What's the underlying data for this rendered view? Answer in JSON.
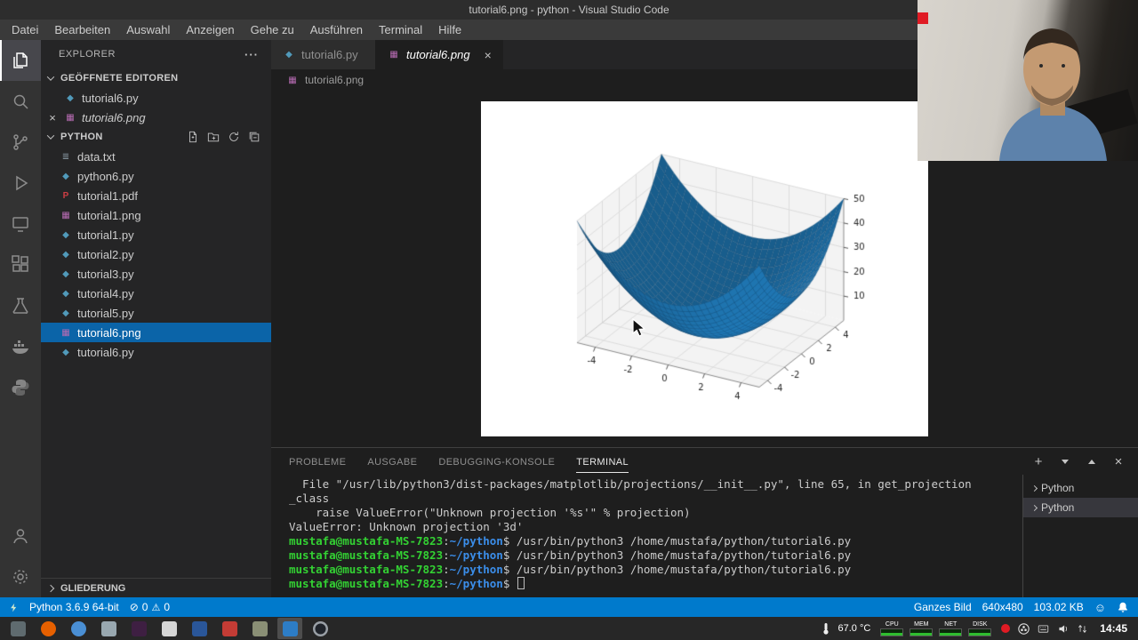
{
  "window": {
    "title": "tutorial6.png - python - Visual Studio Code"
  },
  "menu": {
    "items": [
      "Datei",
      "Bearbeiten",
      "Auswahl",
      "Anzeigen",
      "Gehe zu",
      "Ausführen",
      "Terminal",
      "Hilfe"
    ]
  },
  "activity_bar": {
    "top": [
      {
        "icon": "explorer",
        "active": true
      },
      {
        "icon": "search"
      },
      {
        "icon": "source-control"
      },
      {
        "icon": "run-debug"
      },
      {
        "icon": "remote-explorer"
      },
      {
        "icon": "extensions"
      },
      {
        "icon": "test-explorer"
      },
      {
        "icon": "docker"
      },
      {
        "icon": "python-env"
      }
    ],
    "bottom": [
      {
        "icon": "account"
      },
      {
        "icon": "settings"
      }
    ]
  },
  "sidebar": {
    "title": "EXPLORER",
    "open_editors_label": "GEÖFFNETE EDITOREN",
    "open_editors": [
      {
        "name": "tutorial6.py",
        "type": "py"
      },
      {
        "name": "tutorial6.png",
        "type": "img",
        "italic": true,
        "close": true
      }
    ],
    "folder_label": "PYTHON",
    "files": [
      {
        "name": "data.txt",
        "type": "txt"
      },
      {
        "name": "python6.py",
        "type": "py"
      },
      {
        "name": "tutorial1.pdf",
        "type": "pdf"
      },
      {
        "name": "tutorial1.png",
        "type": "img"
      },
      {
        "name": "tutorial1.py",
        "type": "py"
      },
      {
        "name": "tutorial2.py",
        "type": "py"
      },
      {
        "name": "tutorial3.py",
        "type": "py"
      },
      {
        "name": "tutorial4.py",
        "type": "py"
      },
      {
        "name": "tutorial5.py",
        "type": "py"
      },
      {
        "name": "tutorial6.png",
        "type": "img",
        "selected": true
      },
      {
        "name": "tutorial6.py",
        "type": "py"
      }
    ],
    "outline_label": "GLIEDERUNG"
  },
  "editor": {
    "tabs": [
      {
        "label": "tutorial6.py",
        "type": "py"
      },
      {
        "label": "tutorial6.png",
        "type": "img",
        "active": true,
        "italic": true
      }
    ],
    "breadcrumb": "tutorial6.png"
  },
  "panel": {
    "tabs": [
      "PROBLEME",
      "AUSGABE",
      "DEBUGGING-KONSOLE",
      "TERMINAL"
    ],
    "active_tab": "TERMINAL",
    "terminal_lines": [
      {
        "segments": [
          {
            "t": "  File \"/usr/lib/python3/dist-packages/matplotlib/projections/__init__.py\", line 65, in get_projection",
            "c": "plain"
          }
        ]
      },
      {
        "segments": [
          {
            "t": "_class",
            "c": "plain"
          }
        ]
      },
      {
        "segments": [
          {
            "t": "    raise ValueError(\"Unknown projection '%s'\" % projection)",
            "c": "plain"
          }
        ]
      },
      {
        "segments": [
          {
            "t": "ValueError: Unknown projection '3d'",
            "c": "plain"
          }
        ]
      },
      {
        "segments": [
          {
            "t": "mustafa@mustafa-MS-7823",
            "c": "user"
          },
          {
            "t": ":",
            "c": "plain"
          },
          {
            "t": "~/python",
            "c": "path"
          },
          {
            "t": "$",
            "c": "plain"
          },
          {
            "t": " /usr/bin/python3 /home/mustafa/python/tutorial6.py",
            "c": "plain"
          }
        ]
      },
      {
        "segments": [
          {
            "t": "mustafa@mustafa-MS-7823",
            "c": "user"
          },
          {
            "t": ":",
            "c": "plain"
          },
          {
            "t": "~/python",
            "c": "path"
          },
          {
            "t": "$",
            "c": "plain"
          },
          {
            "t": " /usr/bin/python3 /home/mustafa/python/tutorial6.py",
            "c": "plain"
          }
        ]
      },
      {
        "segments": [
          {
            "t": "mustafa@mustafa-MS-7823",
            "c": "user"
          },
          {
            "t": ":",
            "c": "plain"
          },
          {
            "t": "~/python",
            "c": "path"
          },
          {
            "t": "$",
            "c": "plain"
          },
          {
            "t": " /usr/bin/python3 /home/mustafa/python/tutorial6.py",
            "c": "plain"
          }
        ]
      },
      {
        "segments": [
          {
            "t": "mustafa@mustafa-MS-7823",
            "c": "user"
          },
          {
            "t": ":",
            "c": "plain"
          },
          {
            "t": "~/python",
            "c": "path"
          },
          {
            "t": "$",
            "c": "plain"
          },
          {
            "t": " ",
            "c": "plain"
          }
        ],
        "cursor": true
      }
    ],
    "terminal_list": [
      {
        "label": "Python"
      },
      {
        "label": "Python",
        "selected": true
      }
    ]
  },
  "status_bar": {
    "python_version": "Python 3.6.9 64-bit",
    "error_count": "0",
    "warning_count": "0",
    "zoom_mode": "Ganzes Bild",
    "image_dimensions": "640x480",
    "image_size": "103.02 KB"
  },
  "taskbar": {
    "apps": [
      {
        "name": "app-menu",
        "color": "#5f6b6f",
        "shape": "square"
      },
      {
        "name": "firefox",
        "color": "#e66000",
        "shape": "circle"
      },
      {
        "name": "chromium",
        "color": "#4a8fd4",
        "shape": "circle"
      },
      {
        "name": "file-manager",
        "color": "#99a8b0",
        "shape": "square"
      },
      {
        "name": "terminal-app",
        "color": "#3e1f42",
        "shape": "square"
      },
      {
        "name": "text-editor",
        "color": "#d6d6d6",
        "shape": "square"
      },
      {
        "name": "libreoffice",
        "color": "#2a5699",
        "shape": "square"
      },
      {
        "name": "pdf-reader",
        "color": "#c43c35",
        "shape": "square"
      },
      {
        "name": "image-tool",
        "color": "#8a8f75",
        "shape": "square"
      },
      {
        "name": "vscode",
        "color": "#2d7dc6",
        "shape": "square",
        "active": true
      },
      {
        "name": "obs-studio",
        "color": "#20242b",
        "shape": "circle",
        "ring": true
      }
    ],
    "tray": {
      "temperature": "67.0 °C",
      "meters": [
        "CPU",
        "MEM",
        "NET",
        "DISK"
      ],
      "clock": "14:45"
    }
  },
  "chart_data": {
    "type": "surface",
    "title": "",
    "function": "z = x^2 + y^2",
    "x": {
      "range": [
        -5,
        5
      ],
      "ticks": [
        -4,
        -2,
        0,
        2,
        4
      ]
    },
    "y": {
      "range": [
        -5,
        5
      ],
      "ticks": [
        -4,
        -2,
        0,
        2,
        4
      ]
    },
    "z": {
      "range": [
        0,
        50
      ],
      "ticks": [
        10,
        20,
        30,
        40,
        50
      ]
    },
    "surface_color": "#1f77b4",
    "pane_color": "#f3f3f3",
    "grid_color": "#dcdcdc",
    "mesh_divisions": 30,
    "view": {
      "elev": 30,
      "azim": -60
    },
    "grid": true,
    "legend": false
  }
}
